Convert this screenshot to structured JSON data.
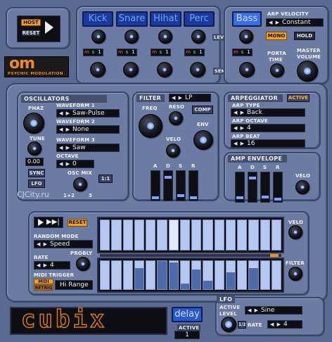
{
  "host": {
    "host_label": "HOST",
    "reset_label": "RESET"
  },
  "brand": {
    "logo": "om",
    "subtitle": "PSYCHIC MODULATION"
  },
  "drums": {
    "tabs": [
      "Kick",
      "Snare",
      "Hihat",
      "Perc"
    ],
    "level_label": "LEVEL",
    "send_label": "SEND",
    "ms": [
      {
        "m": "m",
        "s": "s",
        "n": "1"
      },
      {
        "m": "m",
        "s": "s",
        "n": "1"
      },
      {
        "m": "m",
        "s": "s",
        "n": "1"
      },
      {
        "m": "m",
        "s": "s",
        "n": "1"
      }
    ]
  },
  "bass": {
    "tab": "Bass",
    "arp_velocity_label": "ARP VELOCITY",
    "arp_velocity_value": "Constant",
    "mono_label": "MONO",
    "hold_label": "HOLD",
    "ms": {
      "m": "m",
      "s": "s",
      "n": "1"
    },
    "porta_label": "PORTA",
    "time_label": "TIME",
    "master_label": "MASTER",
    "volume_label": "VOLUME"
  },
  "oscillators": {
    "title": "OSCILLATORS",
    "phaz_label": "PHAZ",
    "tune_label": "TUNE",
    "tune_value": "0.00",
    "sync_label": "SYNC",
    "lfo_label": "LFO",
    "wf1_label": "WAVEFORM 1",
    "wf1_value": "Saw-Pulse",
    "wf2_label": "WAVEFORM 2",
    "wf2_value": "None",
    "wf3_label": "WAVEFORM 3",
    "wf3_value": "Saw",
    "octave_label": "OCTAVE",
    "octave_value": "0",
    "mix_label": "OSC MIX",
    "mix_left": "1+2",
    "mix_right": "3",
    "ratio_label": "1:1",
    "watermark": "CJCity.ru"
  },
  "filter": {
    "title": "FILTER",
    "type_value": "LP",
    "freq_label": "FREQ",
    "reso_label": "RESO",
    "comp_label": "COMP",
    "env_label": "ENV",
    "velo_label": "VELO",
    "adsr": [
      "A",
      "D",
      "S",
      "R"
    ],
    "levels": [
      0.05,
      0.85,
      0.15,
      0.05
    ]
  },
  "arp": {
    "title": "ARPEGGIATOR",
    "active_label": "ACTIVE",
    "type_label": "ARP TYPE",
    "type_value": "Back",
    "octave_label": "ARP OCTAVE",
    "octave_value": "4",
    "beat_label": "ARP BEAT",
    "beat_value": "16"
  },
  "amp": {
    "title": "AMP ENVELOPE",
    "adsr": [
      "A",
      "D",
      "S",
      "R"
    ],
    "levels": [
      0.1,
      0.9,
      0.15,
      0.05
    ],
    "velo_label": "VELO"
  },
  "sequencer": {
    "play_icon": "play-icon",
    "skip_icon": "skip-forward-icon",
    "reset_label": "RESET",
    "random_mode_label": "RANDOM MODE",
    "random_mode_value": "Speed",
    "probly_label": "PROBLY",
    "rate_label": "RATE",
    "rate_value": "4",
    "midi_trigger_label": "MIDI TRIGGER",
    "midi_label": "MIDI",
    "retrig_label": "RETRIG",
    "trigger_value": "Hi Range",
    "velo_label": "VELO",
    "filter_label": "FILTER",
    "velo_steps": [
      1,
      1,
      1,
      1,
      1,
      1,
      1,
      1,
      1,
      1,
      1,
      1,
      1,
      1,
      1,
      1
    ],
    "velo_lit": [
      0,
      0,
      0,
      0,
      0,
      0,
      1,
      0,
      0,
      0,
      0,
      0,
      0,
      0,
      0,
      0
    ],
    "filter_steps": [
      0,
      0,
      0,
      0.75,
      0,
      1,
      0.95,
      0.2,
      0.7,
      0.3,
      0,
      0.6,
      0,
      0.75,
      0,
      0
    ]
  },
  "lfo": {
    "title": "LFO",
    "active_label": "ACTIVE",
    "level_label": "LEVEL",
    "wave_value": "Sine",
    "half_label": "1/2",
    "rate_label": "RATE",
    "rate_value": "4"
  },
  "bottom": {
    "logo": "cubix",
    "delay_label": "delay",
    "active_label": "ACTIVE",
    "active_value": "1"
  },
  "colors": {
    "accent": "#f4a020",
    "lcd": "#0d0f14",
    "panel": "#6b7ba3",
    "tab": "#1b3a9c"
  }
}
